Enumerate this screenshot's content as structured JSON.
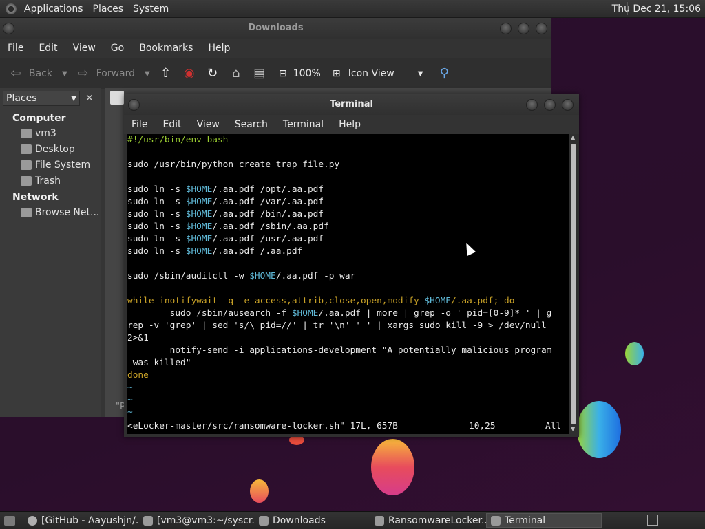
{
  "top_panel": {
    "menus": [
      "Applications",
      "Places",
      "System"
    ],
    "clock": "Thu Dec 21, 15:06"
  },
  "file_manager": {
    "title": "Downloads",
    "menus": [
      "File",
      "Edit",
      "View",
      "Go",
      "Bookmarks",
      "Help"
    ],
    "toolbar": {
      "back": "Back",
      "forward": "Forward",
      "zoom": "100%",
      "view_mode": "Icon View"
    },
    "sidebar": {
      "selector": "Places",
      "sections": [
        {
          "title": "Computer",
          "items": [
            "vm3",
            "Desktop",
            "File System",
            "Trash"
          ]
        },
        {
          "title": "Network",
          "items": [
            "Browse Net..."
          ]
        }
      ]
    },
    "status": "\"R"
  },
  "terminal": {
    "title": "Terminal",
    "menus": [
      "File",
      "Edit",
      "View",
      "Search",
      "Terminal",
      "Help"
    ],
    "lines": [
      "#!/usr/bin/env bash",
      "",
      "sudo /usr/bin/python create_trap_file.py",
      "",
      "sudo ln -s $HOME/.aa.pdf /opt/.aa.pdf",
      "sudo ln -s $HOME/.aa.pdf /var/.aa.pdf",
      "sudo ln -s $HOME/.aa.pdf /bin/.aa.pdf",
      "sudo ln -s $HOME/.aa.pdf /sbin/.aa.pdf",
      "sudo ln -s $HOME/.aa.pdf /usr/.aa.pdf",
      "sudo ln -s $HOME/.aa.pdf /.aa.pdf",
      "",
      "sudo /sbin/auditctl -w $HOME/.aa.pdf -p war",
      "",
      "while inotifywait -q -e access,attrib,close,open,modify $HOME/.aa.pdf; do",
      "        sudo /sbin/ausearch -f $HOME/.aa.pdf | more | grep -o ' pid=[0-9]* ' | g",
      "rep -v 'grep' | sed 's/\\ pid=//' | tr '\\n' ' ' | xargs sudo kill -9 > /dev/null",
      "2>&1",
      "        notify-send -i applications-development \"A potentially malicious program",
      " was killed\"",
      "done",
      "~",
      "~",
      "~"
    ],
    "status_file": "<eLocker-master/src/ransomware-locker.sh\" 17L, 657B",
    "status_pos": "10,25",
    "status_all": "All"
  },
  "taskbar": {
    "tasks": [
      "[GitHub - Aayushjn/...",
      "[vm3@vm3:~/syscr...",
      "Downloads",
      "RansomwareLocker...",
      "Terminal"
    ]
  },
  "colors": {
    "desktop": "#2a0f2c",
    "panel": "#2f2f2f",
    "terminal_bg": "#000000",
    "comment_green": "#9acd32",
    "var_blue": "#5fb8d6",
    "keyword_yellow": "#c9a227",
    "string_red": "#e06070"
  }
}
